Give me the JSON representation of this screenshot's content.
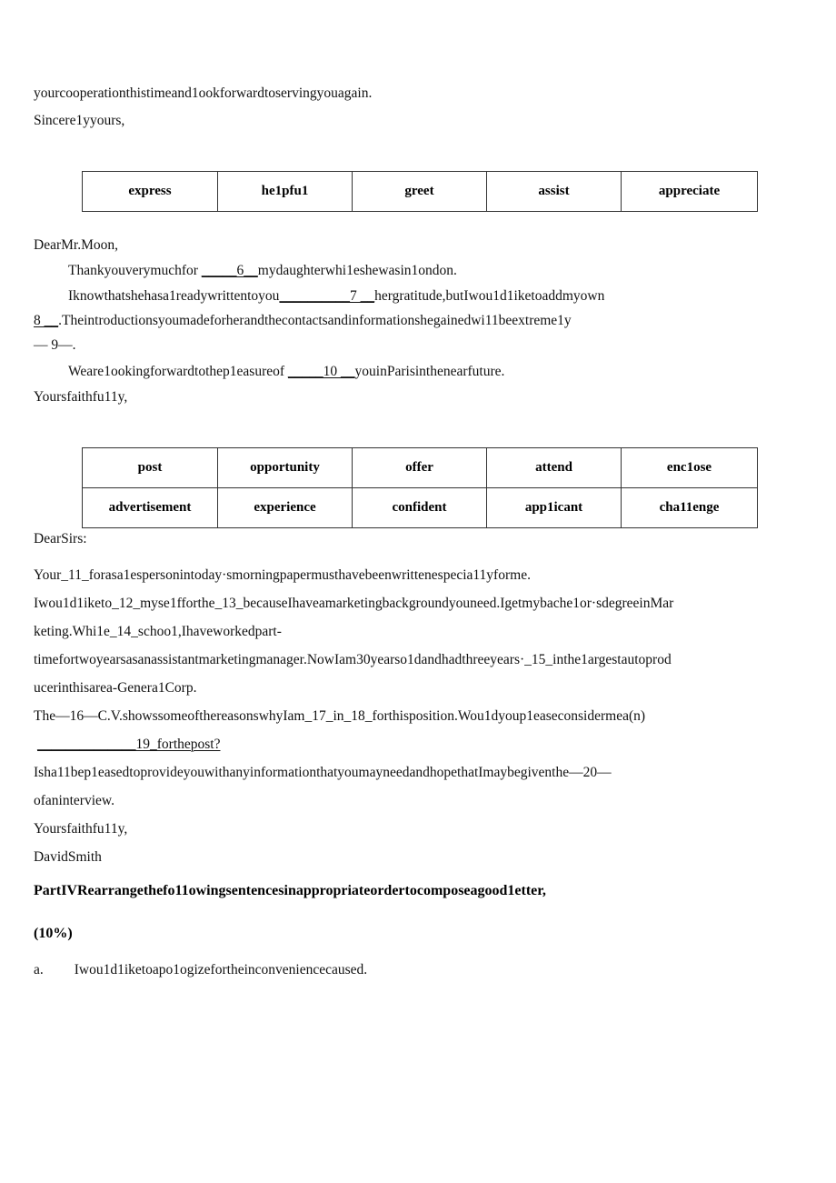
{
  "document": {
    "background_color": "#ffffff",
    "text_color": "#111111",
    "border_color": "#333333"
  },
  "letter_one_tail": {
    "line1": "yourcooperationthistimeand1ookforwardtoservingyouagain.",
    "line2": "Sincere1yyours,"
  },
  "wordbank_one": {
    "rows": [
      [
        "express",
        "he1pfu1",
        "greet",
        "assist",
        "appreciate"
      ]
    ]
  },
  "letter_two": {
    "salutation": "DearMr.Moon,",
    "line1_a": "Thankyouverymuchfor ",
    "line1_blank": "_____6__",
    "line1_b": "mydaughterwhi1eshewasin1ondon.",
    "line2_a": "Iknowthatshehasa1readywrittentoyou",
    "line2_blank": "__________7 __",
    "line2_b": "hergratitude,butIwou1d1iketoaddmyown",
    "line3_a": "8 __",
    "line3_b": ".Theintroductionsyoumadeforherandthecontactsandinformationshegainedwi11beextreme1y",
    "line4": "— 9—.",
    "line5_a": "Weare1ookingforwardtothep1easureof ",
    "line5_blank": "_____10 __",
    "line5_b": "youinParisinthenearfuture.",
    "closing": "Yoursfaithfu11y,"
  },
  "wordbank_two": {
    "rows": [
      [
        "post",
        "opportunity",
        "offer",
        "attend",
        "enc1ose"
      ],
      [
        "advertisement",
        "experience",
        "confident",
        "app1icant",
        "cha11enge"
      ]
    ]
  },
  "letter_three": {
    "salutation": "DearSirs:",
    "line1": "Your_11_forasa1espersonintoday·smorningpapermusthavebeenwrittenespecia11yforme.",
    "line2": "Iwou1d1iketo_12_myse1fforthe_13_becauseIhaveamarketingbackgroundyouneed.Igetmybache1or·sdegreeinMar",
    "line3": "keting.Whi1e_14_schoo1,Ihaveworkedpart-",
    "line4": "timefortwoyearsasanassistantmarketingmanager.NowIam30yearso1dandhadthreeyears·_15_inthe1argestautoprod",
    "line5": "ucerinthisarea-Genera1Corp.",
    "line6": "The—16—C.V.showssomeofthereasonswhyIam_17_in_18_forthisposition.Wou1dyoup1easeconsidermea(n)",
    "line7_blank": "______________",
    "line7_text": "19_forthepost?",
    "line8": "Isha11bep1easedtoprovideyouwithanyinformationthatyoumayneedandhopethatImaybegiventhe—20—",
    "line9": "ofaninterview.",
    "closing": "Yoursfaithfu11y,",
    "signature": "DavidSmith"
  },
  "part_four": {
    "heading": "PartIVRearrangethefo11owingsentencesinappropriateordertocomposeagood1etter,",
    "marks": "(10%)",
    "item_a_label": "a.",
    "item_a_text": "Iwou1d1iketoapo1ogizefortheinconveniencecaused."
  }
}
